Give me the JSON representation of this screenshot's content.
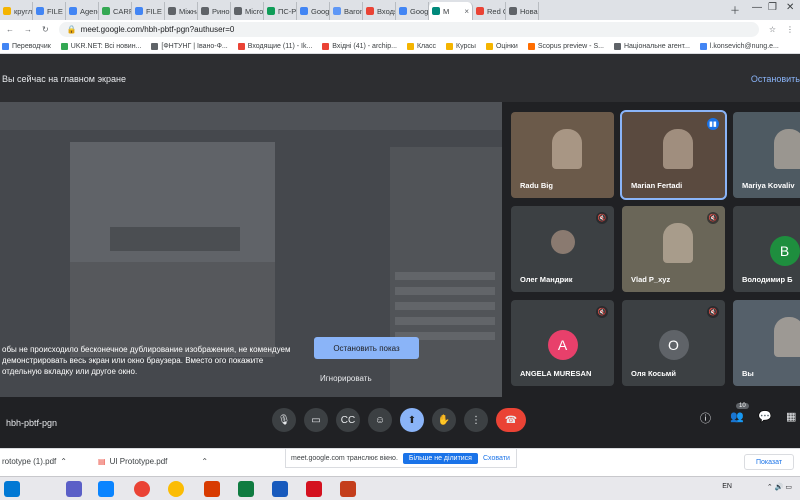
{
  "browser": {
    "tabs": [
      {
        "label": "кругл",
        "color": "#f4b400"
      },
      {
        "label": "FILE VI",
        "color": "#4285f4"
      },
      {
        "label": "Agend",
        "color": "#4285f4"
      },
      {
        "label": "CARPA",
        "color": "#34a853"
      },
      {
        "label": "FILE VI",
        "color": "#4285f4"
      },
      {
        "label": "Міжна",
        "color": "#5f6368"
      },
      {
        "label": "Ринок",
        "color": "#5f6368"
      },
      {
        "label": "Micro",
        "color": "#5f6368"
      },
      {
        "label": "ПС-Ро",
        "color": "#0f9d58"
      },
      {
        "label": "Google",
        "color": "#4285f4"
      },
      {
        "label": "Barom",
        "color": "#5e97f6"
      },
      {
        "label": "Входя",
        "color": "#ea4335"
      },
      {
        "label": "Google",
        "color": "#4285f4"
      },
      {
        "label": "М",
        "color": "#00897b"
      },
      {
        "label": "Red Gr",
        "color": "#ea4335"
      },
      {
        "label": "Нова в",
        "color": "#5f6368"
      }
    ],
    "active_tab_index": 13,
    "url": "meet.google.com/hbh-pbtf-pgn?authuser=0",
    "bookmarks": [
      {
        "label": "Переводчик",
        "color": "#4285f4"
      },
      {
        "label": "UKR.NET: Всі новин...",
        "color": "#34a853"
      },
      {
        "label": "[ФНТУНГ | Івано-Ф...",
        "color": "#5f6368"
      },
      {
        "label": "Входящие (11) - Ik...",
        "color": "#ea4335"
      },
      {
        "label": "Вхідні (41) - archip...",
        "color": "#ea4335"
      },
      {
        "label": "Класс",
        "color": "#f4b400"
      },
      {
        "label": "Курсы",
        "color": "#f4b400"
      },
      {
        "label": "Оцінки",
        "color": "#f4b400"
      },
      {
        "label": "Scopus preview - S...",
        "color": "#ff6d00"
      },
      {
        "label": "Національне агент...",
        "color": "#5f6368"
      },
      {
        "label": "l.konsevich@nung.e...",
        "color": "#4285f4"
      }
    ]
  },
  "meet": {
    "banner_text": "Вы сейчас на главном экране",
    "stop_link": "Остановить",
    "warning_text": "обы не происходило бесконечное дублирование изображения, не комендуем демонстрировать весь экран или окно браузера. Вместо ого покажите отдельную вкладку или другое окно.",
    "stop_show_button": "Остановить показ",
    "ignore_button": "Игнорировать",
    "meeting_code": "hbh-pbtf-pgn",
    "participant_count": "10",
    "participants": [
      {
        "name": "Radu Big",
        "muted": false,
        "avatar": "",
        "avatar_color": ""
      },
      {
        "name": "Marian Fertadi",
        "muted": false,
        "avatar": "",
        "avatar_color": ""
      },
      {
        "name": "Mariya Kovaliv",
        "muted": false,
        "avatar": "",
        "avatar_color": ""
      },
      {
        "name": "Олег Мандрик",
        "muted": true,
        "avatar": "",
        "avatar_color": ""
      },
      {
        "name": "Vlad P_xyz",
        "muted": true,
        "avatar": "",
        "avatar_color": ""
      },
      {
        "name": "Володимир Б",
        "muted": true,
        "avatar": "В",
        "avatar_color": "#1e8e3e"
      },
      {
        "name": "ANGELA MURESAN",
        "muted": true,
        "avatar": "A",
        "avatar_color": "#e8406b"
      },
      {
        "name": "Оля Косьмй",
        "muted": true,
        "avatar": "О",
        "avatar_color": "#5f6368"
      },
      {
        "name": "Вы",
        "muted": false,
        "avatar": "",
        "avatar_color": ""
      }
    ]
  },
  "downloads": {
    "items": [
      "rototype (1).pdf",
      "UI Prototype.pdf"
    ],
    "share_text": "meet.google.com транслює вікно.",
    "share_stop": "Більше не ділитися",
    "share_hide": "Сховати",
    "show_all": "Показат"
  },
  "taskbar": {
    "lang": "EN"
  }
}
